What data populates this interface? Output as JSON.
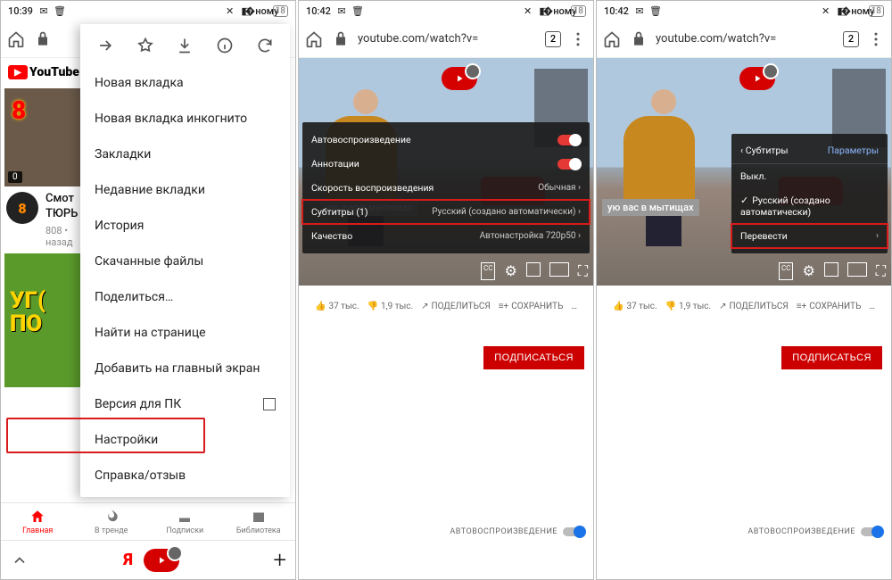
{
  "statusbar": {
    "time1": "10:39",
    "time2": "10:42",
    "time3": "10:42",
    "battery": "18"
  },
  "toolbar": {
    "url": "youtube.com/watch?v=",
    "tabs": "2"
  },
  "menu": {
    "items": [
      "Новая вкладка",
      "Новая вкладка инкогнито",
      "Закладки",
      "Недавние вкладки",
      "История",
      "Скачанные файлы",
      "Поделиться…",
      "Найти на странице",
      "Добавить на главный экран",
      "Версия для ПК",
      "Настройки",
      "Справка/отзыв"
    ]
  },
  "yt": {
    "brand": "YouTube",
    "watch_label": "Смот",
    "watch_label2": "ТЮРЬ",
    "channel": "808 •",
    "ago": "назад",
    "dur": "0"
  },
  "navtabs": [
    "Главная",
    "В тренде",
    "Подписки",
    "Библиотека"
  ],
  "settings": {
    "autoplay": "Автовоспроизведение",
    "annotations": "Аннотации",
    "speed": "Скорость воспроизведения",
    "speed_val": "Обычная",
    "subs": "Субтитры (1)",
    "subs_val": "Русский (создано автоматически)",
    "quality": "Качество",
    "quality_val": "Автонастройка 720p50"
  },
  "settings2": {
    "title": "Субтитры",
    "params": "Параметры",
    "off": "Выкл.",
    "ru": "Русский (создано автоматически)",
    "translate": "Перевести"
  },
  "caption1": "ию вас в мытищах",
  "caption2": "ую вас в мытищах",
  "actions": {
    "like": "37 тыс.",
    "dislike": "1,9 тыс.",
    "share": "ПОДЕЛИТЬСЯ",
    "save": "СОХРАНИТЬ"
  },
  "subscribe": "ПОДПИСАТЬСЯ",
  "autoplay_switch": "АВТОВОСПРОИЗВЕДЕНИЕ",
  "thumb2": {
    "l1": "УГ(",
    "l2": "ПО"
  }
}
